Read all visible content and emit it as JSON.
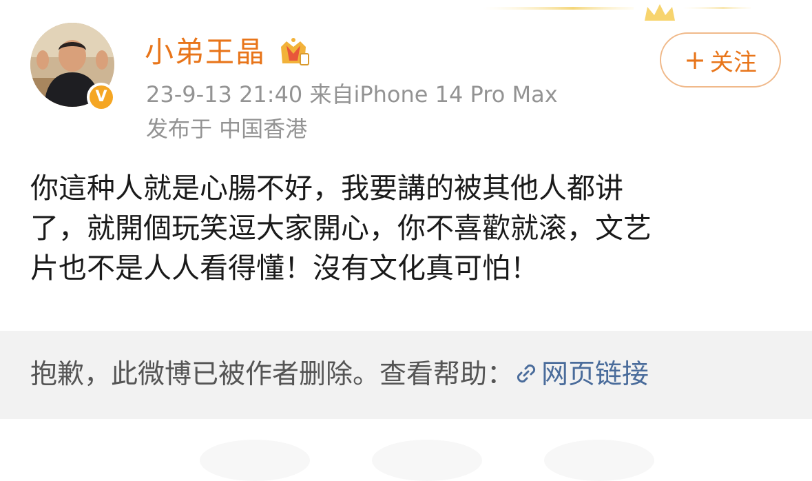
{
  "post": {
    "author": {
      "name": "小弟王晶",
      "verified_icon": "verified-v-icon",
      "verified_glyph": "V",
      "vip_icon": "crown-vip-icon"
    },
    "meta": {
      "time_source": "23-9-13 21:40  来自iPhone 14 Pro Max",
      "location": "发布于 中国香港"
    },
    "follow_button": {
      "plus": "+",
      "label": "关注"
    },
    "content_lines": [
      "你這种人就是心腸不好，我要講的被其他人都讲",
      "了，就開個玩笑逗大家開心，你不喜歡就滚，文艺",
      "片也不是人人看得懂！沒有文化真可怕！"
    ],
    "deleted_notice": {
      "text": "抱歉，此微博已被作者删除。查看帮助：",
      "link_label": "网页链接",
      "link_icon": "link-icon"
    }
  },
  "colors": {
    "accent_orange": "#e8751a",
    "meta_gray": "#939393",
    "link_blue": "#4a6c9b",
    "deleted_bg": "#f2f2f2",
    "badge_gold": "#f5a623"
  }
}
